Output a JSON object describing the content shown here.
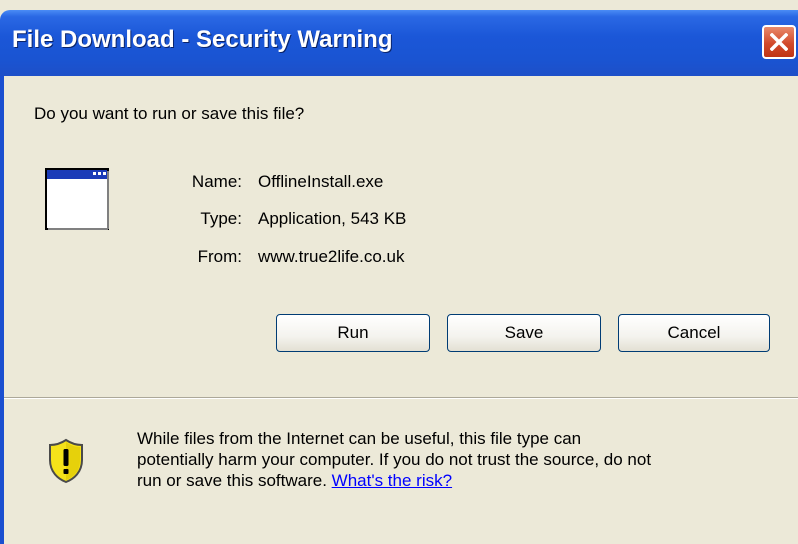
{
  "window": {
    "title": "File Download - Security Warning",
    "title_bar_color": "#1b57d8",
    "close_icon": "close-icon"
  },
  "dialog": {
    "question": "Do you want to run or save this file?",
    "file_icon": "application-window-icon",
    "fields": [
      {
        "label": "Name:",
        "value": "OfflineInstall.exe"
      },
      {
        "label": "Type:",
        "value": "Application, 543 KB"
      },
      {
        "label": "From:",
        "value": "www.true2life.co.uk"
      }
    ],
    "buttons": {
      "run": "Run",
      "save": "Save",
      "cancel": "Cancel"
    }
  },
  "warning": {
    "icon": "shield-warning-icon",
    "line1": "While files from the Internet can be useful, this file type can",
    "line2": "potentially harm your computer. If you do not trust the source, do not",
    "line3_prefix": "run or save this software.",
    "link": "What's the risk?",
    "link_color": "#0000ff"
  },
  "colors": {
    "background": "#ece9d8",
    "shield_yellow": "#f5e21a"
  }
}
